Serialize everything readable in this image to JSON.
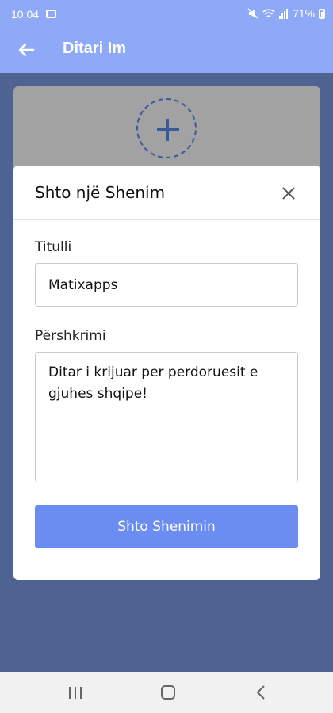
{
  "status_bar": {
    "time": "10:04",
    "battery": "71%"
  },
  "app_bar": {
    "title": "Ditari Im"
  },
  "dialog": {
    "title": "Shto një Shenim",
    "title_label": "Titulli",
    "title_value": "Matixapps",
    "description_label": "Përshkrimi",
    "description_value": "Ditar i krijuar per perdoruesit e gjuhes shqipe!",
    "submit_label": "Shto Shenimin"
  },
  "colors": {
    "app_bar": "#8eaaf6",
    "overlay_background": "#4f6393",
    "primary_button": "#6b8df1"
  },
  "icons": {
    "back": "arrow-left-icon",
    "add": "plus-circle-icon",
    "close": "close-icon"
  }
}
